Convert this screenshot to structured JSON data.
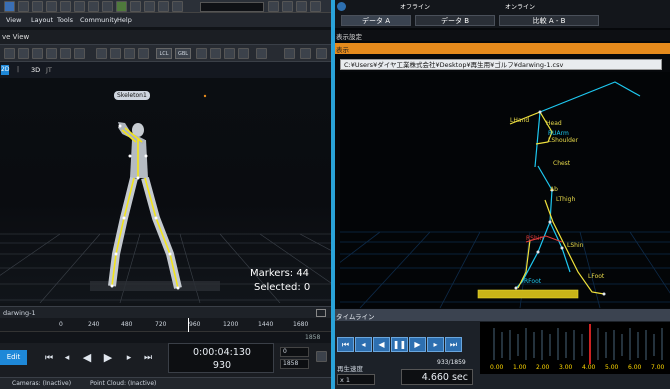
{
  "menubar": {
    "items": [
      "View",
      "Layout",
      "Tools",
      "Community",
      "Help"
    ]
  },
  "view_title": "ve View",
  "mode_tabs": {
    "two_d": "2D",
    "three_d": "3D",
    "jt": "JT"
  },
  "viewport": {
    "skeleton_label": "Skeleton1",
    "markers_text": "Markers: 44",
    "selected_text": "Selected: 0"
  },
  "toolbar2": {
    "lcl": "LCL",
    "gbl": "GBL"
  },
  "timeline": {
    "take_name": "darwing-1",
    "ticks": [
      "0",
      "240",
      "480",
      "720",
      "960",
      "1200",
      "1440",
      "1680"
    ],
    "end_frame": "1858"
  },
  "transport": {
    "edit_label": "Edit",
    "timecode": "0:00:04:130",
    "frame": "930",
    "start_frame": "0",
    "end_frame": "1858"
  },
  "statusbar": {
    "cameras": "Cameras: (Inactive)",
    "point_cloud": "Point Cloud: (Inactive)"
  },
  "right": {
    "top_labels": {
      "offline": "オフライン",
      "online": "オンライン"
    },
    "tabs": [
      "データ A",
      "データ B",
      "比較 A - B"
    ],
    "setting_label": "表示設定",
    "display_label": "表示",
    "file_path": "C:¥Users¥ダイヤ工業株式会社¥Desktop¥再生用¥ゴルフ¥darwing-1.csv",
    "joints": {
      "lhand": "LHand",
      "head": "Head",
      "rarm": "RUArm",
      "lshoulder": "LShoulder",
      "chest": "Chest",
      "ab": "Ab",
      "lthigh": "LThigh",
      "rshin": "RShin",
      "lshin": "LShin",
      "rfoot": "RFoot",
      "lfoot": "LFoot"
    },
    "timeline_label": "タイムライン",
    "frame_counter": "933/1859",
    "speed_label": "再生速度",
    "speed_value": "x 1",
    "time_value": "4.660 sec",
    "wave_ticks": [
      "0.00",
      "1.00",
      "2.00",
      "3.00",
      "4.00",
      "5.00",
      "6.00",
      "7.00"
    ]
  },
  "colors": {
    "accent": "#2aa3d9",
    "orange": "#e58a1c",
    "skeleton_right": "#1ec8f0",
    "skeleton_left": "#f0e23c"
  }
}
